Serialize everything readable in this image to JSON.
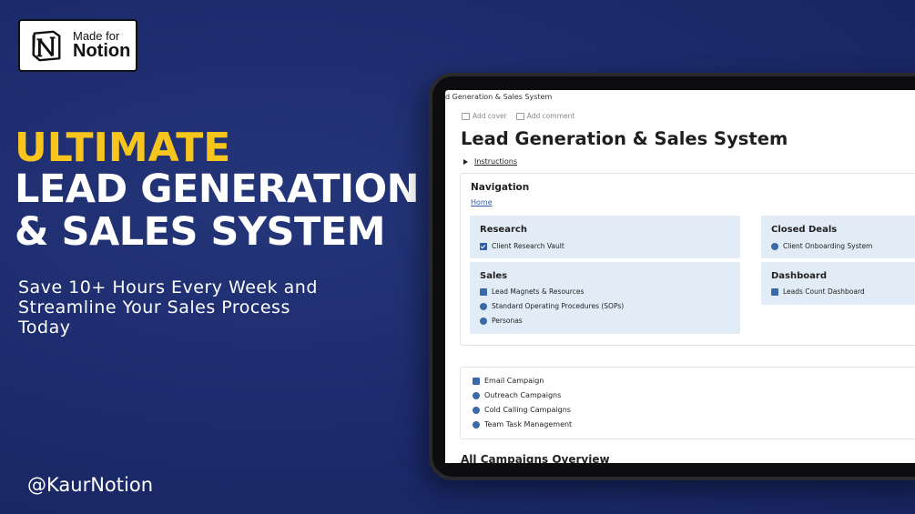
{
  "badge": {
    "line1": "Made for",
    "line2": "Notion"
  },
  "headline": {
    "line1": "ULTIMATE",
    "line2": "LEAD GENERATION",
    "line3": "&  SALES SYSTEM"
  },
  "subtitle": "Save 10+ Hours Every Week and Streamline Your Sales Process Today",
  "handle": "@KaurNotion",
  "colors": {
    "background": "#1b2a6b",
    "accent": "#f8c51c",
    "card": "#e1ecf7"
  },
  "notion_page": {
    "breadcrumb": "d Generation & Sales System",
    "add_cover": "Add cover",
    "add_comment": "Add comment",
    "title": "Lead Generation & Sales System",
    "instructions": "Instructions",
    "navigation": {
      "title": "Navigation",
      "home": "Home",
      "cards": [
        {
          "title": "Research",
          "items": [
            {
              "icon": "checkbox-icon",
              "label": "Client Research Vault"
            }
          ]
        },
        {
          "title": "Closed Deals",
          "items": [
            {
              "icon": "people-icon",
              "label": "Client Onboarding System"
            }
          ]
        },
        {
          "title": "Sales",
          "items": [
            {
              "icon": "stack-icon",
              "label": "Lead Magnets & Resources"
            },
            {
              "icon": "gear-icon",
              "label": "Standard Operating Procedures (SOPs)"
            },
            {
              "icon": "person-icon",
              "label": "Personas"
            }
          ]
        },
        {
          "title": "Dashboard",
          "items": [
            {
              "icon": "chart-icon",
              "label": "Leads Count Dashboard"
            }
          ]
        }
      ]
    },
    "campaigns": [
      {
        "icon": "mail-icon",
        "label": "Email Campaign"
      },
      {
        "icon": "megaphone-icon",
        "label": "Outreach Campaigns"
      },
      {
        "icon": "phone-icon",
        "label": "Cold Calling Campaigns"
      },
      {
        "icon": "people-icon",
        "label": "Team Task Management"
      }
    ],
    "overview_heading": "All Campaigns Overview"
  }
}
